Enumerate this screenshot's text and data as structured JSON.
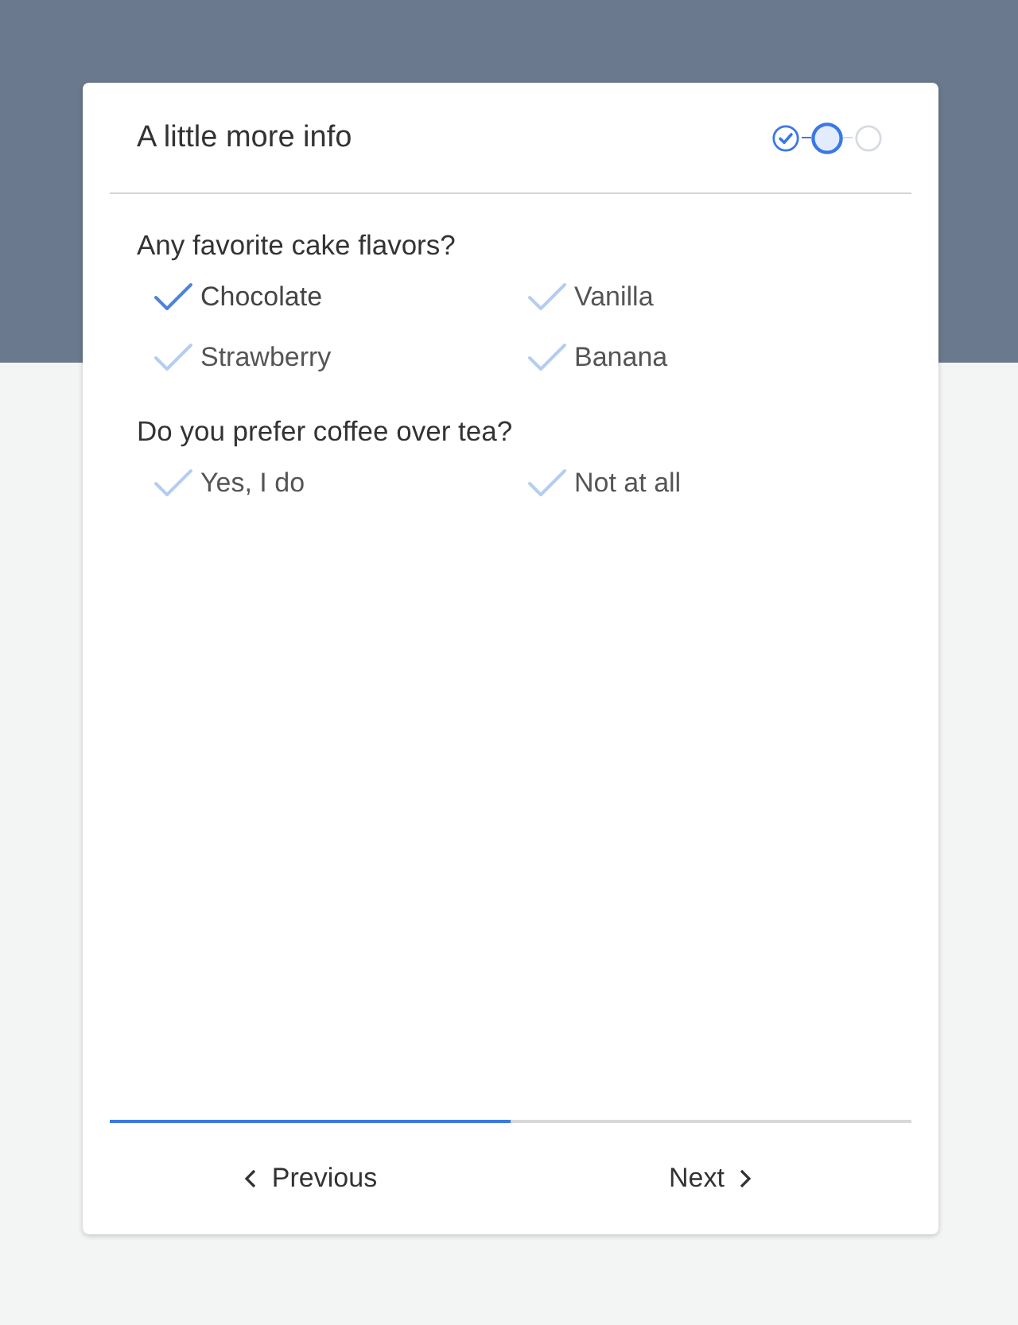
{
  "card": {
    "title": "A little more info",
    "steps": [
      {
        "done": true,
        "selected": false
      },
      {
        "done": false,
        "selected": true
      },
      {
        "done": false,
        "selected": false
      }
    ],
    "questions": [
      {
        "label": "Any favorite cake flavors?",
        "options": [
          {
            "label": "Chocolate",
            "checked": true
          },
          {
            "label": "Vanilla",
            "checked": false
          },
          {
            "label": "Strawberry",
            "checked": false
          },
          {
            "label": "Banana",
            "checked": false
          }
        ]
      },
      {
        "label": "Do you prefer coffee over tea?",
        "options": [
          {
            "label": "Yes, I do",
            "checked": false
          },
          {
            "label": "Not at all",
            "checked": false
          }
        ]
      }
    ],
    "progress": {
      "level": 0.5
    },
    "buttons": [
      {
        "label": "Previous",
        "kind": "back"
      },
      {
        "label": "Next",
        "kind": "forward"
      }
    ]
  }
}
